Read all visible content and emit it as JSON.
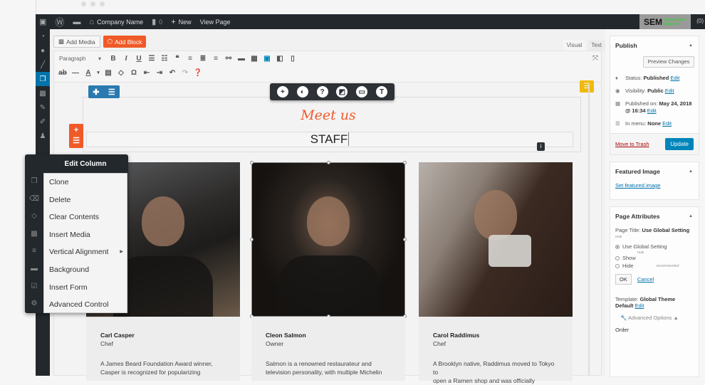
{
  "admin_bar": {
    "site_name": "Company Name",
    "comments_count": "0",
    "new_label": "New",
    "view_page_label": "View Page",
    "sem_logo": "SEM",
    "sem_sub": "SearchEngine Magazine",
    "cart_count": "(0)"
  },
  "sidebar": {
    "items": [
      "dashboard-icon",
      "lightbulb-icon",
      "brush-icon",
      "pages-icon",
      "media-icon",
      "pin-icon",
      "plugin-icon",
      "users-icon"
    ],
    "active": "pages-icon"
  },
  "editor": {
    "add_media_label": "Add Media",
    "add_block_label": "Add Block",
    "tabs": [
      "Visual",
      "Text"
    ],
    "active_tab": "Visual",
    "format_select": "Paragraph",
    "toolbar_row1": [
      "B",
      "I",
      "U",
      "≡",
      "≡",
      "❝",
      "≡",
      "≡",
      "≡",
      "🔗",
      "▬",
      "▦",
      "▣",
      "◧",
      "▯"
    ],
    "toolbar_row2": [
      "—",
      "—",
      "A",
      "▾",
      "📋",
      "◇",
      "Ω",
      "⇥",
      "⇤",
      "↶",
      "↷",
      "?"
    ]
  },
  "block_toolbar": {
    "icons": [
      "+",
      "◐",
      "?",
      "◩",
      "▭",
      "T"
    ]
  },
  "content": {
    "heading_script": "Meet us",
    "heading_main": "STAFF",
    "accent_color": "#f05a28"
  },
  "context_menu": {
    "title": "Edit Column",
    "items": [
      "Clone",
      "Delete",
      "Clear Contents",
      "Insert Media",
      "Vertical Alignment",
      "Background",
      "Insert Form",
      "Advanced Control"
    ],
    "icons": [
      "clone-icon",
      "delete-icon",
      "eraser-icon",
      "media-icon",
      "align-icon",
      "background-icon",
      "form-icon",
      "gear-icon"
    ]
  },
  "staff": [
    {
      "name": "Carl Casper",
      "role": "Chef",
      "bio_line1": "A James Beard Foundation Award winner,",
      "bio_line2": "Casper is recognized for popularizing"
    },
    {
      "name": "Cleon Salmon",
      "role": "Owner",
      "bio_line1": "Salmon is a renowned restaurateur and",
      "bio_line2": "television personality, with multiple Michelin"
    },
    {
      "name": "Carol Raddimus",
      "role": "Chef",
      "bio_line1": "A Brooklyn native, Raddimus moved to Tokyo to",
      "bio_line2": "open a Ramen shop and was officially"
    }
  ],
  "publish": {
    "title": "Publish",
    "preview_label": "Preview Changes",
    "status_label": "Status:",
    "status_value": "Published",
    "visibility_label": "Visibility:",
    "visibility_value": "Public",
    "published_on_label": "Published on:",
    "published_on_value": "May 24, 2018",
    "published_time": "@ 16:34",
    "menu_label": "In menu:",
    "menu_value": "None",
    "edit_label": "Edit",
    "trash_label": "Move to Trash",
    "update_label": "Update"
  },
  "featured_image": {
    "title": "Featured Image",
    "link": "Set featured image"
  },
  "page_attributes": {
    "title": "Page Attributes",
    "page_title_label": "Page Title:",
    "page_title_value": "Use Global Setting",
    "hide_hint": "Hide",
    "options": [
      "Use Global Setting",
      "Show",
      "Hide"
    ],
    "selected": "Use Global Setting",
    "hide_sub": "Hide",
    "recommended": "recommended",
    "ok_label": "OK",
    "cancel_label": "Cancel",
    "template_label": "Template:",
    "template_value": "Global Theme Default",
    "edit_label": "Edit",
    "advanced_label": "Advanced Options",
    "order_label": "Order"
  }
}
